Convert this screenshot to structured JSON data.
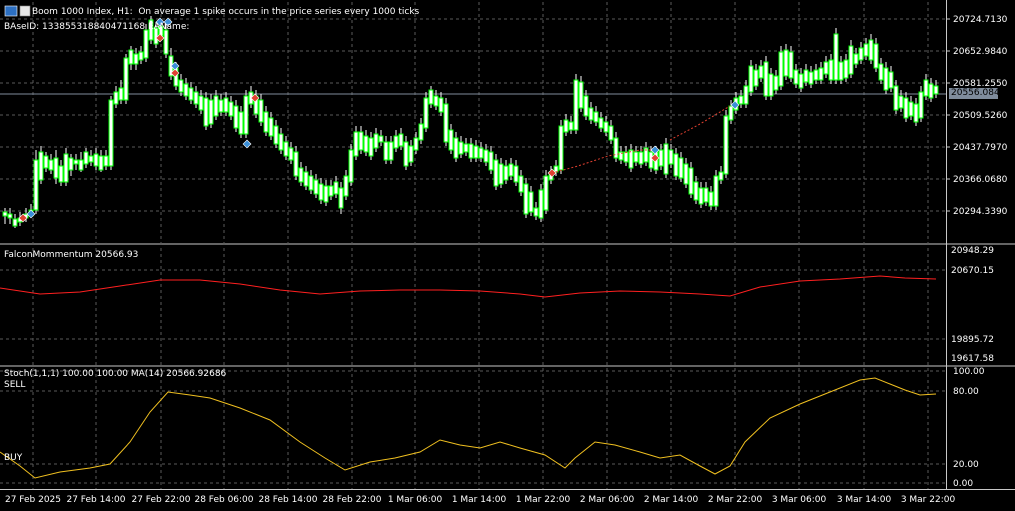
{
  "header": {
    "title": "Boom 1000 Index, H1:  On average 1 spike occurs in the price series every 1000 ticks",
    "base_id": "BAseID: 133855318840471168 EAName:"
  },
  "main_pane": {
    "price_labels": [
      "20724.7130",
      "20652.9840",
      "20581.2550",
      "20509.5260",
      "20437.7970",
      "20366.0680",
      "20294.3390"
    ],
    "current_price": "20556.0840"
  },
  "falcon_pane": {
    "title": "FalconMommentum 20566.93",
    "price_labels": [
      "20948.29",
      "20670.15",
      "19895.72",
      "19617.58"
    ],
    "line_color": "#ff2020"
  },
  "stoch_pane": {
    "title": "Stoch(1,1,1) 100.00 100.00 MA(14) 20566.92686",
    "sell_label": "SELL",
    "buy_label": "BUY",
    "levels": [
      "100.00",
      "80.00",
      "20.00",
      "0.00"
    ],
    "line_color": "#f0c020"
  },
  "time_axis": [
    "27 Feb 2025",
    "27 Feb 14:00",
    "27 Feb 22:00",
    "28 Feb 06:00",
    "28 Feb 14:00",
    "28 Feb 22:00",
    "1 Mar 06:00",
    "1 Mar 14:00",
    "1 Mar 22:00",
    "2 Mar 06:00",
    "2 Mar 14:00",
    "2 Mar 22:00",
    "3 Mar 06:00",
    "3 Mar 14:00",
    "3 Mar 22:00"
  ],
  "colors": {
    "bull": "#ffffff",
    "bear": "#00ff00",
    "grid": "#5a5a5a",
    "buy_marker": "#3a8fd8",
    "sell_marker": "#e04030"
  }
}
